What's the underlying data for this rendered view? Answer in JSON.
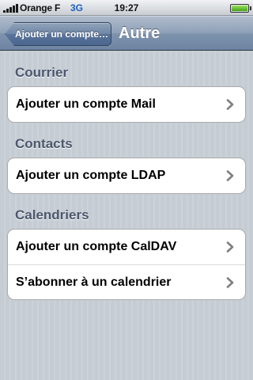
{
  "status_bar": {
    "carrier": "Orange F",
    "network": "3G",
    "time": "19:27",
    "battery_level": 1.0,
    "signal_bars": 5
  },
  "nav_bar": {
    "back_label": "Ajouter un compte…",
    "title": "Autre"
  },
  "sections": {
    "mail": {
      "header": "Courrier",
      "rows": [
        "Ajouter un compte Mail"
      ]
    },
    "contacts": {
      "header": "Contacts",
      "rows": [
        "Ajouter un compte LDAP"
      ]
    },
    "calendars": {
      "header": "Calendriers",
      "rows": [
        "Ajouter un compte CalDAV",
        "S’abonner à un calendrier"
      ]
    }
  },
  "icons": {
    "row_disclosure": "chevron-right-icon",
    "battery": "battery-icon",
    "signal": "signal-strength-icon"
  },
  "colors": {
    "background": "#c5ccd4",
    "nav_bar": "#6d84a2",
    "section_header": "#4c566c",
    "chevron": "#7f7f7f"
  }
}
